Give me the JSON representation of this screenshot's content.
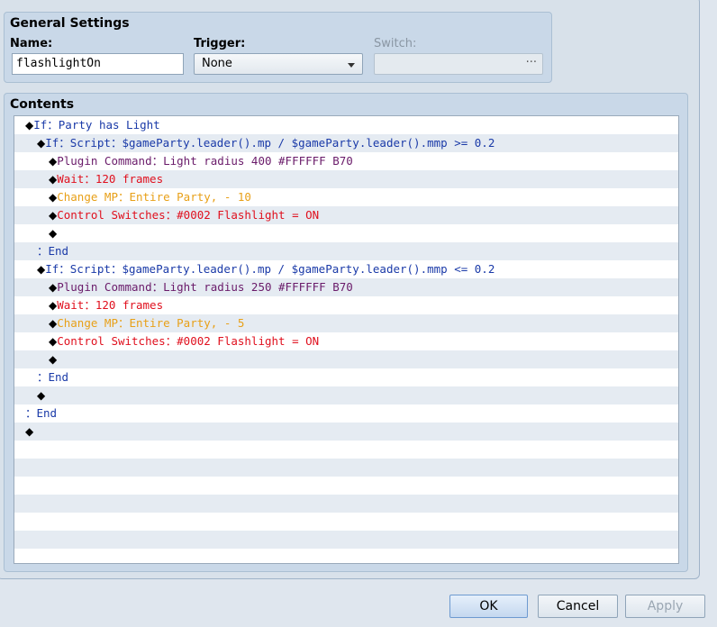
{
  "general": {
    "title": "General Settings",
    "name_label": "Name:",
    "name_value": "flashlightOn",
    "trigger_label": "Trigger:",
    "trigger_value": "None",
    "switch_label": "Switch:",
    "switch_value": "",
    "switch_button": "···"
  },
  "contents": {
    "title": "Contents",
    "rows": [
      {
        "indent": 0,
        "parts": [
          {
            "t": "◆",
            "c": "diamond"
          },
          {
            "t": "If：Party has Light",
            "c": "c-blue"
          }
        ]
      },
      {
        "indent": 1,
        "parts": [
          {
            "t": "◆",
            "c": "diamond"
          },
          {
            "t": "If：Script：$gameParty.leader().mp / $gameParty.leader().mmp >= 0.2",
            "c": "c-blue"
          }
        ]
      },
      {
        "indent": 2,
        "parts": [
          {
            "t": "◆",
            "c": "diamond"
          },
          {
            "t": "Plugin Command：",
            "c": "c-purple"
          },
          {
            "t": "Light radius 400 #FFFFFF B70",
            "c": "c-purple"
          }
        ]
      },
      {
        "indent": 2,
        "parts": [
          {
            "t": "◆",
            "c": "diamond"
          },
          {
            "t": "Wait：120 frames",
            "c": "c-red"
          }
        ]
      },
      {
        "indent": 2,
        "parts": [
          {
            "t": "◆",
            "c": "diamond"
          },
          {
            "t": "Change MP：Entire Party, - 10",
            "c": "c-orange"
          }
        ]
      },
      {
        "indent": 2,
        "parts": [
          {
            "t": "◆",
            "c": "diamond"
          },
          {
            "t": "Control Switches：#0002 Flashlight = ON",
            "c": "c-red"
          }
        ]
      },
      {
        "indent": 2,
        "parts": [
          {
            "t": "◆",
            "c": "diamond"
          }
        ]
      },
      {
        "indent": 1,
        "parts": [
          {
            "t": "：End",
            "c": "c-end"
          }
        ]
      },
      {
        "indent": 1,
        "parts": [
          {
            "t": "◆",
            "c": "diamond"
          },
          {
            "t": "If：Script：$gameParty.leader().mp / $gameParty.leader().mmp <= 0.2",
            "c": "c-blue"
          }
        ]
      },
      {
        "indent": 2,
        "parts": [
          {
            "t": "◆",
            "c": "diamond"
          },
          {
            "t": "Plugin Command：",
            "c": "c-purple"
          },
          {
            "t": "Light radius 250 #FFFFFF B70",
            "c": "c-purple"
          }
        ]
      },
      {
        "indent": 2,
        "parts": [
          {
            "t": "◆",
            "c": "diamond"
          },
          {
            "t": "Wait：120 frames",
            "c": "c-red"
          }
        ]
      },
      {
        "indent": 2,
        "parts": [
          {
            "t": "◆",
            "c": "diamond"
          },
          {
            "t": "Change MP：Entire Party, - 5",
            "c": "c-orange"
          }
        ]
      },
      {
        "indent": 2,
        "parts": [
          {
            "t": "◆",
            "c": "diamond"
          },
          {
            "t": "Control Switches：#0002 Flashlight = ON",
            "c": "c-red"
          }
        ]
      },
      {
        "indent": 2,
        "parts": [
          {
            "t": "◆",
            "c": "diamond"
          }
        ]
      },
      {
        "indent": 1,
        "parts": [
          {
            "t": "：End",
            "c": "c-end"
          }
        ]
      },
      {
        "indent": 1,
        "parts": [
          {
            "t": "◆",
            "c": "diamond"
          }
        ]
      },
      {
        "indent": 0,
        "parts": [
          {
            "t": "：End",
            "c": "c-end"
          }
        ]
      },
      {
        "indent": 0,
        "parts": [
          {
            "t": "◆",
            "c": "diamond"
          }
        ]
      },
      {
        "indent": 0,
        "parts": []
      },
      {
        "indent": 0,
        "parts": []
      },
      {
        "indent": 0,
        "parts": []
      },
      {
        "indent": 0,
        "parts": []
      },
      {
        "indent": 0,
        "parts": []
      },
      {
        "indent": 0,
        "parts": []
      },
      {
        "indent": 0,
        "parts": []
      }
    ]
  },
  "buttons": {
    "ok": "OK",
    "cancel": "Cancel",
    "apply": "Apply"
  }
}
